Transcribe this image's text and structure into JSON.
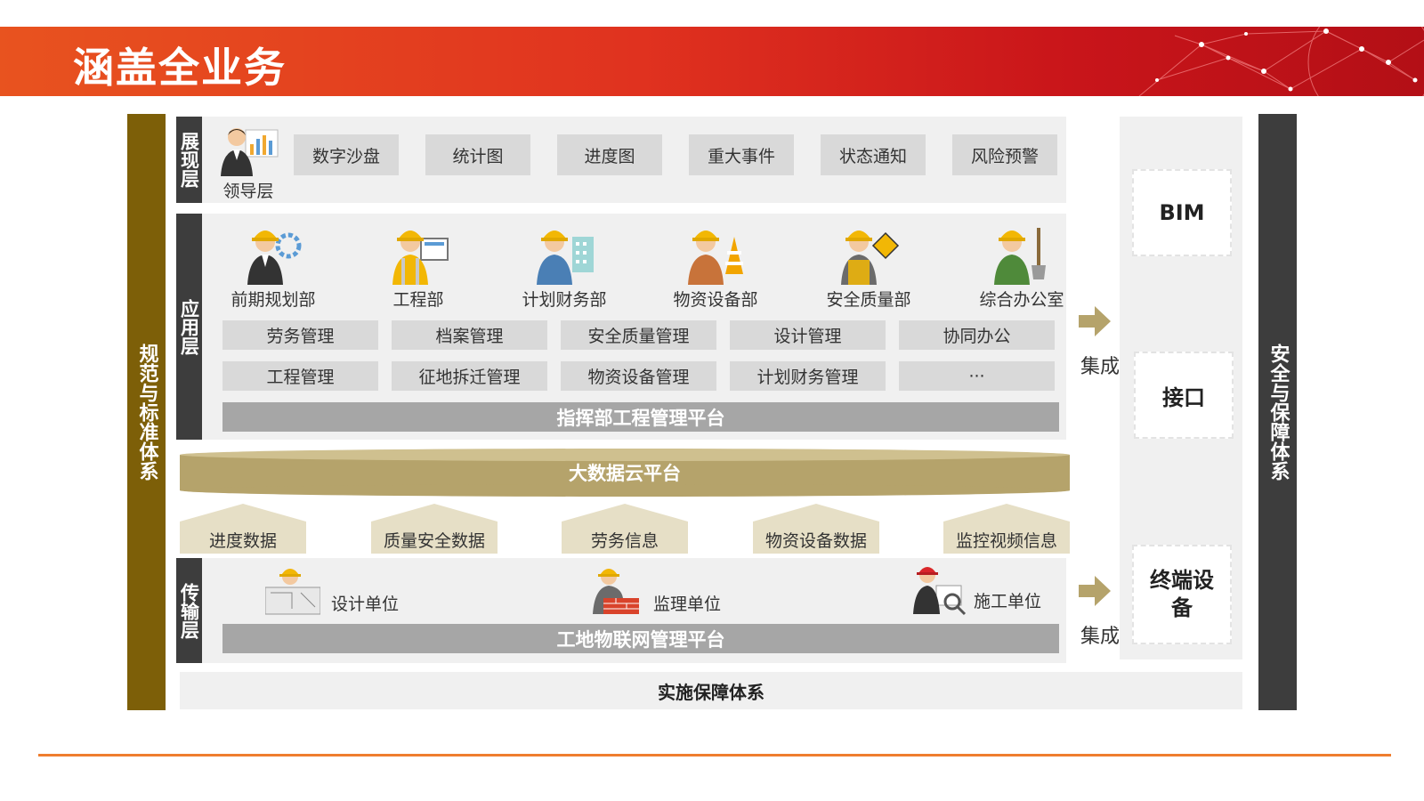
{
  "header": {
    "title": "涵盖全业务"
  },
  "left_side": {
    "label": "规范与标准体系"
  },
  "right_side": {
    "label": "安全与保障体系"
  },
  "presentation_layer": {
    "tag": "展现层",
    "person_label": "领导层",
    "items": [
      "数字沙盘",
      "统计图",
      "进度图",
      "重大事件",
      "状态通知",
      "风险预警"
    ]
  },
  "application_layer": {
    "tag": "应用层",
    "departments": [
      "前期规划部",
      "工程部",
      "计划财务部",
      "物资设备部",
      "安全质量部",
      "综合办公室"
    ],
    "row1": [
      "劳务管理",
      "档案管理",
      "安全质量管理",
      "设计管理",
      "协同办公"
    ],
    "row2": [
      "工程管理",
      "征地拆迁管理",
      "物资设备管理",
      "计划财务管理",
      "···"
    ],
    "platform": "指挥部工程管理平台"
  },
  "cloud": {
    "label": "大数据云平台"
  },
  "data_items": [
    "进度数据",
    "质量安全数据",
    "劳务信息",
    "物资设备数据",
    "监控视频信息"
  ],
  "transport_layer": {
    "tag": "传输层",
    "units": [
      "设计单位",
      "监理单位",
      "施工单位"
    ],
    "platform": "工地物联网管理平台"
  },
  "integration": {
    "label_top": "集成",
    "label_bottom": "集成",
    "boxes": [
      "BIM",
      "接口",
      "终端设备"
    ]
  },
  "implementation": {
    "label": "实施保障体系"
  },
  "colors": {
    "header_orange": "#e8531f",
    "header_red": "#b30f16",
    "left_side": "#7d5f08",
    "dark_tag": "#3d3d3d",
    "chip_gray": "#d9d9d9",
    "platform_gray": "#a6a6a6",
    "cloud_gold": "#b5a36b",
    "data_beige": "#e6dfc6"
  }
}
